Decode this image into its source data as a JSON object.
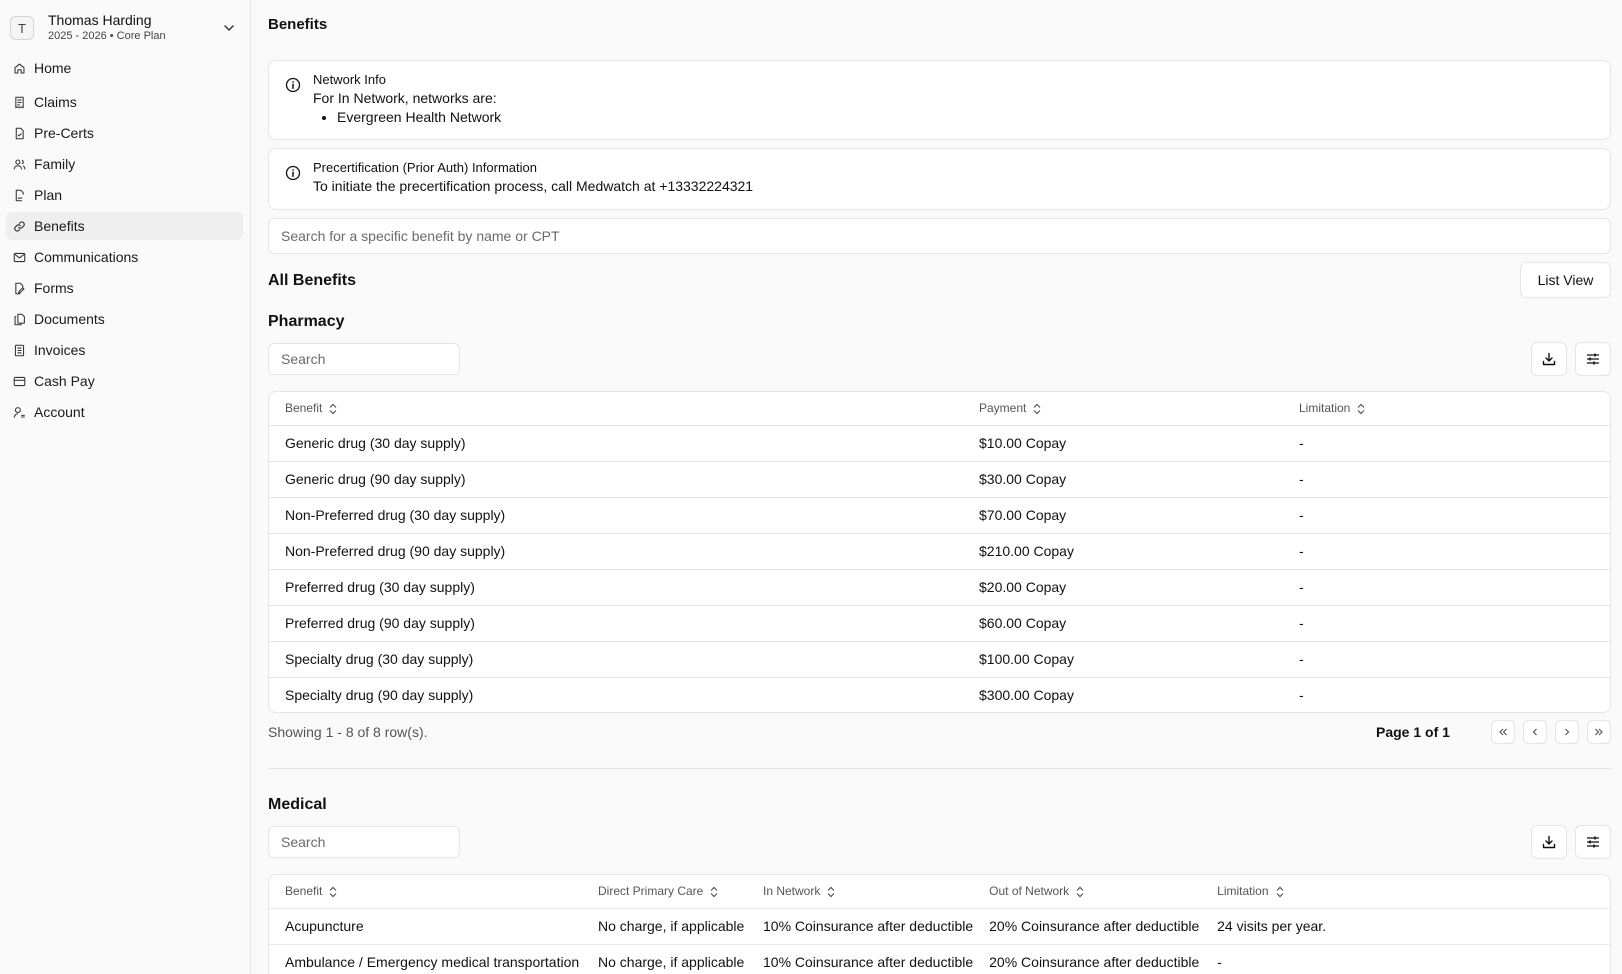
{
  "user": {
    "name": "Thomas Harding",
    "plan": "2025 - 2026 • Core Plan",
    "initial": "T"
  },
  "nav": [
    {
      "label": "Home",
      "icon": "home-icon"
    },
    {
      "label": "Claims",
      "icon": "receipt-icon"
    },
    {
      "label": "Pre-Certs",
      "icon": "file-check-icon"
    },
    {
      "label": "Family",
      "icon": "users-icon"
    },
    {
      "label": "Plan",
      "icon": "file-signature-icon"
    },
    {
      "label": "Benefits",
      "icon": "link-icon",
      "active": true
    },
    {
      "label": "Communications",
      "icon": "mail-icon"
    },
    {
      "label": "Forms",
      "icon": "file-edit-icon"
    },
    {
      "label": "Documents",
      "icon": "files-icon"
    },
    {
      "label": "Invoices",
      "icon": "invoice-icon"
    },
    {
      "label": "Cash Pay",
      "icon": "credit-card-icon"
    },
    {
      "label": "Account",
      "icon": "user-cog-icon"
    }
  ],
  "page": {
    "title": "Benefits"
  },
  "network_alert": {
    "title": "Network Info",
    "text": "For In Network, networks are:",
    "items": [
      "Evergreen Health Network"
    ]
  },
  "precert_alert": {
    "title": "Precertification (Prior Auth) Information",
    "text": "To initiate the precertification process, call Medwatch at +13332224321"
  },
  "search": {
    "placeholder": "Search for a specific benefit by name or CPT"
  },
  "all_benefits": {
    "title": "All Benefits",
    "view_button": "List View"
  },
  "pharmacy": {
    "title": "Pharmacy",
    "search_placeholder": "Search",
    "columns": [
      "Benefit",
      "Payment",
      "Limitation"
    ],
    "rows": [
      [
        "Generic drug (30 day supply)",
        "$10.00 Copay",
        "-"
      ],
      [
        "Generic drug (90 day supply)",
        "$30.00 Copay",
        "-"
      ],
      [
        "Non-Preferred drug (30 day supply)",
        "$70.00 Copay",
        "-"
      ],
      [
        "Non-Preferred drug (90 day supply)",
        "$210.00 Copay",
        "-"
      ],
      [
        "Preferred drug (30 day supply)",
        "$20.00 Copay",
        "-"
      ],
      [
        "Preferred drug (90 day supply)",
        "$60.00 Copay",
        "-"
      ],
      [
        "Specialty drug (30 day supply)",
        "$100.00 Copay",
        "-"
      ],
      [
        "Specialty drug (90 day supply)",
        "$300.00 Copay",
        "-"
      ]
    ],
    "showing": "Showing 1 - 8 of 8 row(s).",
    "page_indicator": "Page 1 of 1"
  },
  "medical": {
    "title": "Medical",
    "search_placeholder": "Search",
    "columns": [
      "Benefit",
      "Direct Primary Care",
      "In Network",
      "Out of Network",
      "Limitation"
    ],
    "rows": [
      [
        "Acupuncture",
        "No charge, if applicable",
        "10% Coinsurance after deductible",
        "20% Coinsurance after deductible",
        "24 visits per year."
      ],
      [
        "Ambulance / Emergency medical transportation",
        "No charge, if applicable",
        "10% Coinsurance after deductible",
        "20% Coinsurance after deductible",
        "-"
      ]
    ]
  }
}
